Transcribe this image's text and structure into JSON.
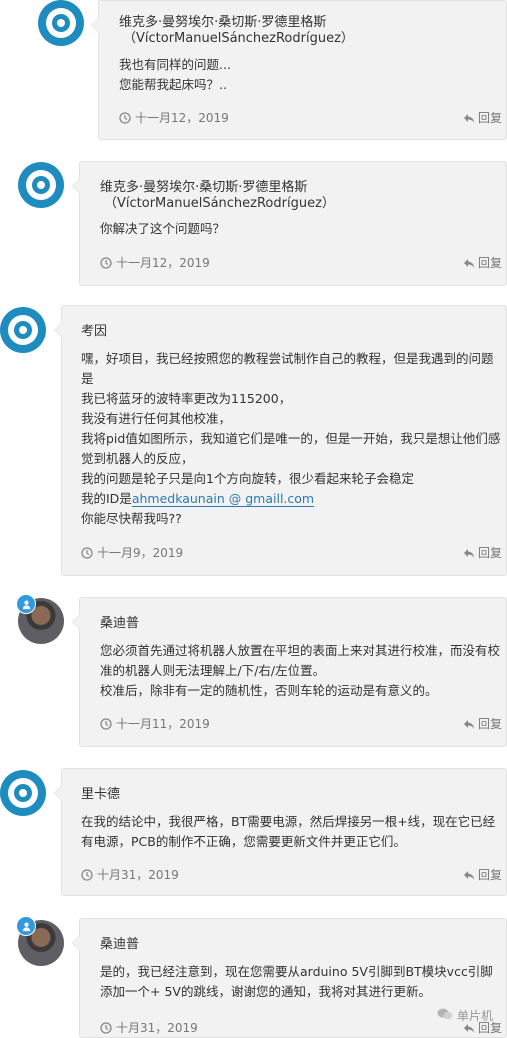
{
  "comments": [
    {
      "author_line1": "维克多·曼努埃尔·桑切斯·罗德里格斯",
      "author_line2": "（VíctorManuelSánchezRodríguez）",
      "text_lines": [
        "我也有同样的问题...",
        "您能帮我起床吗？.."
      ],
      "date": "十一月12，2019",
      "reply_label": "回复"
    },
    {
      "author_line1": "维克多·曼努埃尔·桑切斯·罗德里格斯",
      "author_line2": "（VíctorManuelSánchezRodríguez）",
      "text_lines": [
        "你解决了这个问题吗？"
      ],
      "date": "十一月12，2019",
      "reply_label": "回复"
    },
    {
      "author": "考因",
      "text_lines": [
        "嘿，好项目，我已经按照您的教程尝试制作自己的教程，但是我遇到的问题是",
        "我已将蓝牙的波特率更改为115200，",
        "我没有进行任何其他校准，",
        "我将pid值如图所示，我知道它们是唯一的，但是一开始，我只是想让他们感觉到机器人的反应，",
        "我的问题是轮子只是向1个方向旋转，很少看起来轮子会稳定"
      ],
      "id_prefix": "我的ID是",
      "email": "ahmedkaunain @ gmaill.com",
      "last_line": "你能尽快帮我吗??",
      "date": "十一月9，2019",
      "reply_label": "回复"
    },
    {
      "author": "桑迪普",
      "text_lines": [
        "您必须首先通过将机器人放置在平坦的表面上来对其进行校准，而没有校准的机器人则无法理解上/下/右/左位置。",
        "校准后，除非有一定的随机性，否则车轮的运动是有意义的。"
      ],
      "date": "十一月11，2019",
      "reply_label": "回复"
    },
    {
      "author": "里卡德",
      "text_lines": [
        "在我的结论中，我很严格，BT需要电源，然后焊接另一根+线，现在它已经有电源，PCB的制作不正确，您需要更新文件并更正它们。"
      ],
      "date": "十月31，2019",
      "reply_label": "回复"
    },
    {
      "author": "桑迪普",
      "text_lines": [
        "是的，我已经注意到，现在您需要从arduino 5V引脚到BT模块vcc引脚添加一个+ 5V的跳线，谢谢您的通知，我将对其进行更新。"
      ],
      "date": "十月31，2019",
      "reply_label": "回复"
    }
  ],
  "watermark": "单片机",
  "icons": {
    "clock": "clock-icon",
    "reply": "reply-icon",
    "avatar_default": "wordpress-avatar-icon",
    "badge": "user-badge-icon"
  },
  "colors": {
    "avatar_blue": "#1e8cbe",
    "card_bg": "#f2f2f2",
    "link": "#2a7ab0",
    "badge_blue": "#3399dd"
  }
}
